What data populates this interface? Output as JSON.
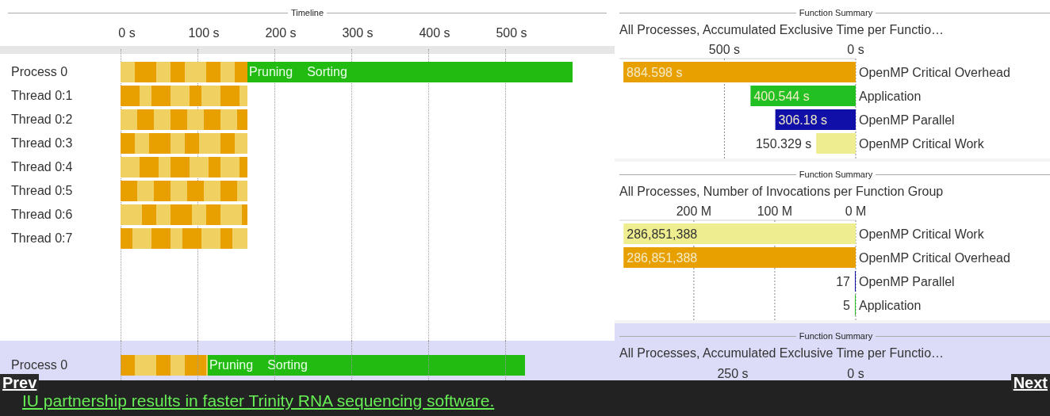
{
  "timeline": {
    "header": "Timeline",
    "ticks": [
      "0 s",
      "100 s",
      "200 s",
      "300 s",
      "400 s",
      "500 s"
    ],
    "rows": [
      {
        "label": "Process 0",
        "kind": "process",
        "segments": [
          "Pruning",
          "Sorting"
        ]
      },
      {
        "label": "Thread 0:1",
        "kind": "thread"
      },
      {
        "label": "Thread 0:2",
        "kind": "thread"
      },
      {
        "label": "Thread 0:3",
        "kind": "thread"
      },
      {
        "label": "Thread 0:4",
        "kind": "thread"
      },
      {
        "label": "Thread 0:5",
        "kind": "thread"
      },
      {
        "label": "Thread 0:6",
        "kind": "thread"
      },
      {
        "label": "Thread 0:7",
        "kind": "thread"
      }
    ],
    "second_rows": [
      {
        "label": "Process 0",
        "kind": "process",
        "segments": [
          "Pruning",
          "Sorting"
        ]
      }
    ]
  },
  "summaries": [
    {
      "header": "Function Summary",
      "title": "All Processes, Accumulated Exclusive Time per Functio…",
      "chart_data": {
        "type": "bar",
        "orientation": "horizontal",
        "categories": [
          "OpenMP Critical Overhead",
          "Application",
          "OpenMP Parallel",
          "OpenMP Critical Work"
        ],
        "values": [
          884.598,
          400.544,
          306.18,
          150.329
        ],
        "colors": [
          "#e8a000",
          "#22c022",
          "#1010a8",
          "#eeee90"
        ],
        "value_labels": [
          "884.598 s",
          "400.544 s",
          "306.18 s",
          "150.329 s"
        ],
        "xlim": [
          900,
          0
        ],
        "xticks": [
          {
            "value": 500,
            "label": "500 s"
          },
          {
            "value": 0,
            "label": "0 s"
          }
        ]
      }
    },
    {
      "header": "Function Summary",
      "title": "All Processes, Number of Invocations per Function Group",
      "chart_data": {
        "type": "bar",
        "orientation": "horizontal",
        "categories": [
          "OpenMP Critical Work",
          "OpenMP Critical Overhead",
          "OpenMP Parallel",
          "Application"
        ],
        "values": [
          286851388,
          286851388,
          17,
          5
        ],
        "colors": [
          "#eeee90",
          "#e8a000",
          "#1010a8",
          "#22c022"
        ],
        "value_labels": [
          "286,851,388",
          "286,851,388",
          "17",
          "5"
        ],
        "xlim": [
          292000000,
          0
        ],
        "xticks": [
          {
            "value": 200000000,
            "label": "200 M"
          },
          {
            "value": 100000000,
            "label": "100 M"
          },
          {
            "value": 0,
            "label": "0 M"
          }
        ]
      }
    },
    {
      "header": "Function Summary",
      "title": "All Processes, Accumulated Exclusive Time per Functio…",
      "ticks": [
        "250 s",
        "0 s"
      ]
    }
  ],
  "caption": {
    "prev": "Prev",
    "next": "Next",
    "link": "IU partnership results in faster Trinity RNA sequencing software."
  }
}
